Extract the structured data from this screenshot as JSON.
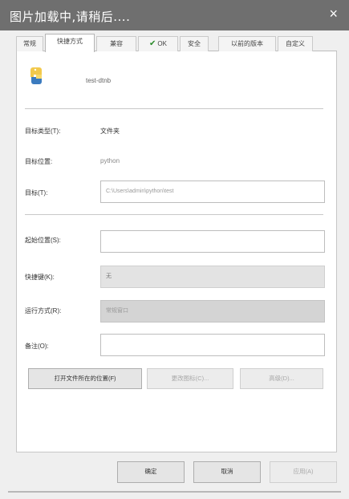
{
  "overlay": {
    "loading_text": "图片加载中,请稍后....",
    "close": "×"
  },
  "tabs": [
    {
      "label": "常规",
      "active": false
    },
    {
      "label": "快捷方式",
      "active": true
    },
    {
      "label": "兼容",
      "active": false
    },
    {
      "label": "OK",
      "active": false,
      "check": true
    },
    {
      "label": "安全",
      "active": false
    },
    {
      "label": "以前的版本",
      "active": false
    },
    {
      "label": "自定义",
      "active": false
    }
  ],
  "app": {
    "icon": "python-icon",
    "name": "test-dtnb"
  },
  "fields": {
    "target_type_label": "目标类型(T):",
    "target_type_value": "文件夹",
    "target_location_label": "目标位置:",
    "target_location_value": "python",
    "target_label": "目标(T):",
    "target_value": "C:\\Users\\admin\\python\\test",
    "start_in_label": "起始位置(S):",
    "start_in_value": "",
    "shortcut_key_label": "快捷键(K):",
    "shortcut_key_value": "无",
    "run_label": "运行方式(R):",
    "run_value": "常规窗口",
    "comment_label": "备注(O):",
    "comment_value": ""
  },
  "buttons": {
    "open_location": "打开文件所在的位置(F)",
    "change_icon": "更改图标(C)...",
    "advanced": "高级(D)..."
  },
  "footer": {
    "ok": "确定",
    "cancel": "取消",
    "apply": "应用(A)"
  }
}
